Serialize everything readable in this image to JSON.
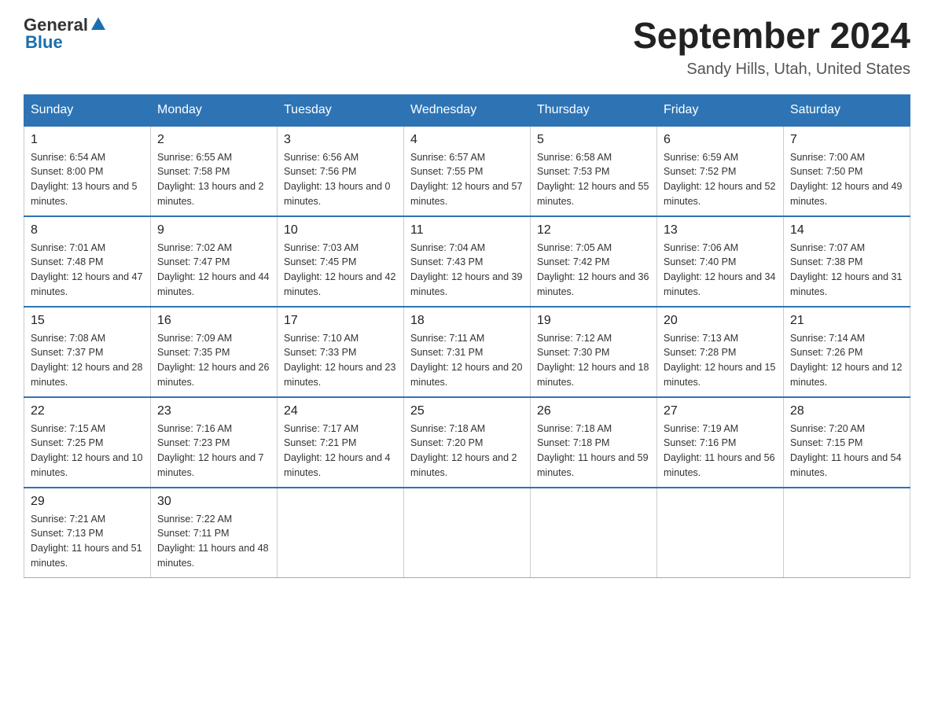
{
  "header": {
    "logo_general": "General",
    "logo_blue": "Blue",
    "month_year": "September 2024",
    "location": "Sandy Hills, Utah, United States"
  },
  "weekdays": [
    "Sunday",
    "Monday",
    "Tuesday",
    "Wednesday",
    "Thursday",
    "Friday",
    "Saturday"
  ],
  "weeks": [
    [
      {
        "day": "1",
        "sunrise": "6:54 AM",
        "sunset": "8:00 PM",
        "daylight": "13 hours and 5 minutes."
      },
      {
        "day": "2",
        "sunrise": "6:55 AM",
        "sunset": "7:58 PM",
        "daylight": "13 hours and 2 minutes."
      },
      {
        "day": "3",
        "sunrise": "6:56 AM",
        "sunset": "7:56 PM",
        "daylight": "13 hours and 0 minutes."
      },
      {
        "day": "4",
        "sunrise": "6:57 AM",
        "sunset": "7:55 PM",
        "daylight": "12 hours and 57 minutes."
      },
      {
        "day": "5",
        "sunrise": "6:58 AM",
        "sunset": "7:53 PM",
        "daylight": "12 hours and 55 minutes."
      },
      {
        "day": "6",
        "sunrise": "6:59 AM",
        "sunset": "7:52 PM",
        "daylight": "12 hours and 52 minutes."
      },
      {
        "day": "7",
        "sunrise": "7:00 AM",
        "sunset": "7:50 PM",
        "daylight": "12 hours and 49 minutes."
      }
    ],
    [
      {
        "day": "8",
        "sunrise": "7:01 AM",
        "sunset": "7:48 PM",
        "daylight": "12 hours and 47 minutes."
      },
      {
        "day": "9",
        "sunrise": "7:02 AM",
        "sunset": "7:47 PM",
        "daylight": "12 hours and 44 minutes."
      },
      {
        "day": "10",
        "sunrise": "7:03 AM",
        "sunset": "7:45 PM",
        "daylight": "12 hours and 42 minutes."
      },
      {
        "day": "11",
        "sunrise": "7:04 AM",
        "sunset": "7:43 PM",
        "daylight": "12 hours and 39 minutes."
      },
      {
        "day": "12",
        "sunrise": "7:05 AM",
        "sunset": "7:42 PM",
        "daylight": "12 hours and 36 minutes."
      },
      {
        "day": "13",
        "sunrise": "7:06 AM",
        "sunset": "7:40 PM",
        "daylight": "12 hours and 34 minutes."
      },
      {
        "day": "14",
        "sunrise": "7:07 AM",
        "sunset": "7:38 PM",
        "daylight": "12 hours and 31 minutes."
      }
    ],
    [
      {
        "day": "15",
        "sunrise": "7:08 AM",
        "sunset": "7:37 PM",
        "daylight": "12 hours and 28 minutes."
      },
      {
        "day": "16",
        "sunrise": "7:09 AM",
        "sunset": "7:35 PM",
        "daylight": "12 hours and 26 minutes."
      },
      {
        "day": "17",
        "sunrise": "7:10 AM",
        "sunset": "7:33 PM",
        "daylight": "12 hours and 23 minutes."
      },
      {
        "day": "18",
        "sunrise": "7:11 AM",
        "sunset": "7:31 PM",
        "daylight": "12 hours and 20 minutes."
      },
      {
        "day": "19",
        "sunrise": "7:12 AM",
        "sunset": "7:30 PM",
        "daylight": "12 hours and 18 minutes."
      },
      {
        "day": "20",
        "sunrise": "7:13 AM",
        "sunset": "7:28 PM",
        "daylight": "12 hours and 15 minutes."
      },
      {
        "day": "21",
        "sunrise": "7:14 AM",
        "sunset": "7:26 PM",
        "daylight": "12 hours and 12 minutes."
      }
    ],
    [
      {
        "day": "22",
        "sunrise": "7:15 AM",
        "sunset": "7:25 PM",
        "daylight": "12 hours and 10 minutes."
      },
      {
        "day": "23",
        "sunrise": "7:16 AM",
        "sunset": "7:23 PM",
        "daylight": "12 hours and 7 minutes."
      },
      {
        "day": "24",
        "sunrise": "7:17 AM",
        "sunset": "7:21 PM",
        "daylight": "12 hours and 4 minutes."
      },
      {
        "day": "25",
        "sunrise": "7:18 AM",
        "sunset": "7:20 PM",
        "daylight": "12 hours and 2 minutes."
      },
      {
        "day": "26",
        "sunrise": "7:18 AM",
        "sunset": "7:18 PM",
        "daylight": "11 hours and 59 minutes."
      },
      {
        "day": "27",
        "sunrise": "7:19 AM",
        "sunset": "7:16 PM",
        "daylight": "11 hours and 56 minutes."
      },
      {
        "day": "28",
        "sunrise": "7:20 AM",
        "sunset": "7:15 PM",
        "daylight": "11 hours and 54 minutes."
      }
    ],
    [
      {
        "day": "29",
        "sunrise": "7:21 AM",
        "sunset": "7:13 PM",
        "daylight": "11 hours and 51 minutes."
      },
      {
        "day": "30",
        "sunrise": "7:22 AM",
        "sunset": "7:11 PM",
        "daylight": "11 hours and 48 minutes."
      },
      null,
      null,
      null,
      null,
      null
    ]
  ]
}
